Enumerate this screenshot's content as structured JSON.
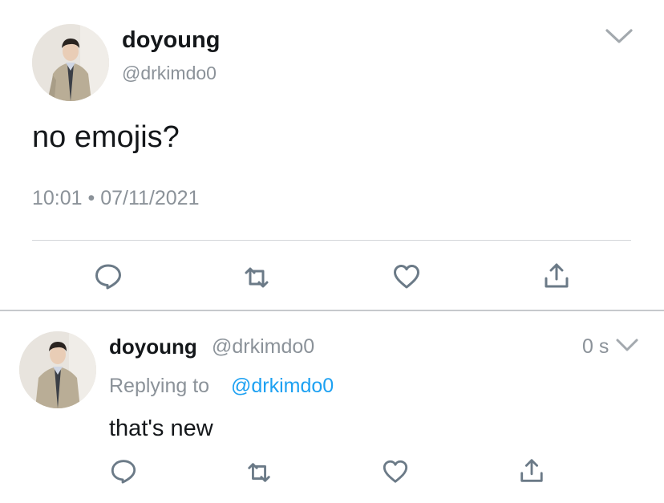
{
  "main_tweet": {
    "display_name": "doyoung",
    "handle": "@drkimdo0",
    "text": "no emojis?",
    "timestamp": "10:01 • 07/11/2021",
    "avatar": "profile-photo-man-in-suit",
    "menu_icon": "chevron-down-icon"
  },
  "actions": {
    "reply_icon": "reply-icon",
    "retweet_icon": "retweet-icon",
    "like_icon": "heart-icon",
    "share_icon": "share-icon"
  },
  "reply_tweet": {
    "display_name": "doyoung",
    "handle": "@drkimdo0",
    "time_ago": "0 s",
    "replying_prefix": "Replying to",
    "replying_to": "@drkimdo0",
    "text": "that's new",
    "avatar": "profile-photo-man-in-suit"
  },
  "colors": {
    "text_primary": "#14171a",
    "text_secondary": "#8b9299",
    "link": "#1da1f2",
    "divider": "#d3d6d9"
  }
}
